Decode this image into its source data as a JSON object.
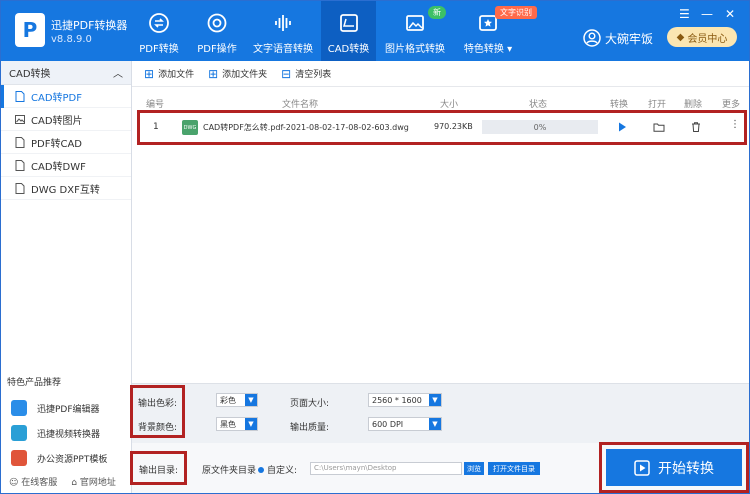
{
  "header": {
    "app_name": "迅捷PDF转换器",
    "version": "v8.8.9.0",
    "nav": [
      {
        "label": "PDF转换",
        "icon": "convert-icon"
      },
      {
        "label": "PDF操作",
        "icon": "gear-icon"
      },
      {
        "label": "文字语音转换",
        "icon": "audio-icon"
      },
      {
        "label": "CAD转换",
        "icon": "cad-icon",
        "active": true
      },
      {
        "label": "图片格式转换",
        "icon": "image-icon",
        "badge": "新"
      },
      {
        "label": "特色转换",
        "icon": "feature-icon",
        "badge": "文字识别"
      }
    ],
    "user_name": "大碗牢饭",
    "vip_label": "会员中心"
  },
  "sidebar": {
    "section_title": "CAD转换",
    "items": [
      "CAD转PDF",
      "CAD转图片",
      "PDF转CAD",
      "CAD转DWF",
      "DWG DXF互转"
    ],
    "featured_title": "特色产品推荐",
    "featured": [
      "迅捷PDF编辑器",
      "迅捷视频转换器",
      "办公资源PPT模板"
    ],
    "footer": [
      "在线客服",
      "官网地址"
    ]
  },
  "toolbar": {
    "add_file": "添加文件",
    "add_folder": "添加文件夹",
    "clear_list": "清空列表"
  },
  "table": {
    "headers": [
      "编号",
      "文件名称",
      "大小",
      "状态",
      "转换",
      "打开",
      "删除",
      "更多"
    ],
    "rows": [
      {
        "num": "1",
        "name": "CAD转PDF怎么转.pdf-2021-08-02-17-08-02-603.dwg",
        "size": "970.23KB",
        "progress": "0%",
        "file_tag": "DWG"
      }
    ]
  },
  "settings": {
    "color_label": "输出色彩:",
    "color_value": "彩色",
    "bg_label": "背景颜色:",
    "bg_value": "黑色",
    "page_label": "页面大小:",
    "page_value": "2560 * 1600",
    "quality_label": "输出质量:",
    "quality_value": "600 DPI"
  },
  "output": {
    "label": "输出目录:",
    "option_source": "原文件夹目录",
    "option_custom": "自定义:",
    "path": "C:\\Users\\mayn\\Desktop",
    "browse": "浏览",
    "open_folder": "打开文件目录"
  },
  "start_button": "开始转换",
  "colors": {
    "brand": "#1677e0",
    "highlight": "#b22222"
  }
}
